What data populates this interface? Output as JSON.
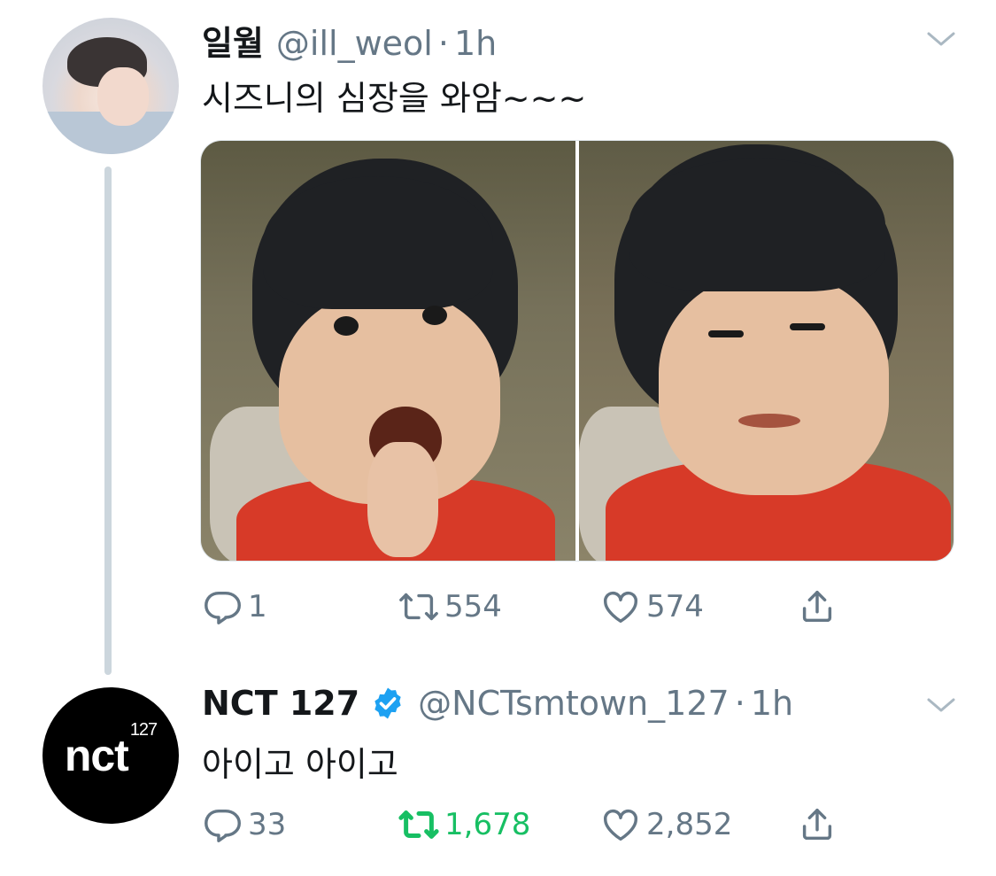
{
  "tweets": [
    {
      "display_name": "일월",
      "handle": "@ill_weol",
      "separator": "·",
      "time": "1h",
      "text": "시즈니의 심장을 와암~~~",
      "replies": "1",
      "retweets": "554",
      "likes": "574",
      "retweeted": false
    },
    {
      "display_name": "NCT 127",
      "verified": true,
      "handle": "@NCTsmtown_127",
      "separator": "·",
      "time": "1h",
      "text": "아이고 아이고",
      "replies": "33",
      "retweets": "1,678",
      "likes": "2,852",
      "retweeted": true,
      "avatar_logo": "nct",
      "avatar_logo_sup": "127"
    }
  ],
  "icons": {
    "reply": "reply-icon",
    "retweet": "retweet-icon",
    "like": "heart-icon",
    "share": "share-icon",
    "caret": "chevron-down-icon",
    "verified": "verified-badge-icon"
  },
  "colors": {
    "text_primary": "#14171a",
    "text_secondary": "#657786",
    "verified_blue": "#1da1f2",
    "retweet_green": "#17bf63",
    "thread_line": "#ccd6dd"
  }
}
